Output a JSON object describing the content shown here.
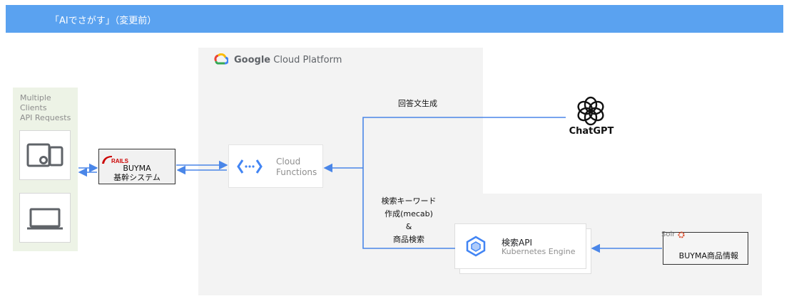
{
  "title": "「AIでさがす」（変更前）",
  "region": {
    "logo": "google-cloud-logo",
    "brand": "Google",
    "product": "Cloud Platform"
  },
  "clients": {
    "label": "Multiple\nClients\nAPI Requests",
    "icons": [
      "mobile-devices-icon",
      "laptop-icon"
    ]
  },
  "rails": {
    "logo_text": "RAILS",
    "label": "BUYMA\n基幹システム"
  },
  "cloud_functions": {
    "label": "Cloud\nFunctions",
    "icon": "cloud-functions-icon"
  },
  "chatgpt": {
    "label": "ChatGPT",
    "icon": "openai-logo-icon"
  },
  "search_api": {
    "title": "検索API",
    "subtitle": "Kubernetes Engine",
    "icon": "kubernetes-engine-icon"
  },
  "solr": {
    "logo_text": "Solr",
    "label": "BUYMA商品情報"
  },
  "edges": {
    "generate": "回答文生成",
    "search": "検索キーワード\n作成(mecab)\n&\n商品検索"
  },
  "colors": {
    "title_bar": "#5aa2f0",
    "arrow": "#4a86e8",
    "gcp_bg": "#f3f3f3",
    "clients_bg": "#edf3e6",
    "rails_red": "#cc0000"
  }
}
